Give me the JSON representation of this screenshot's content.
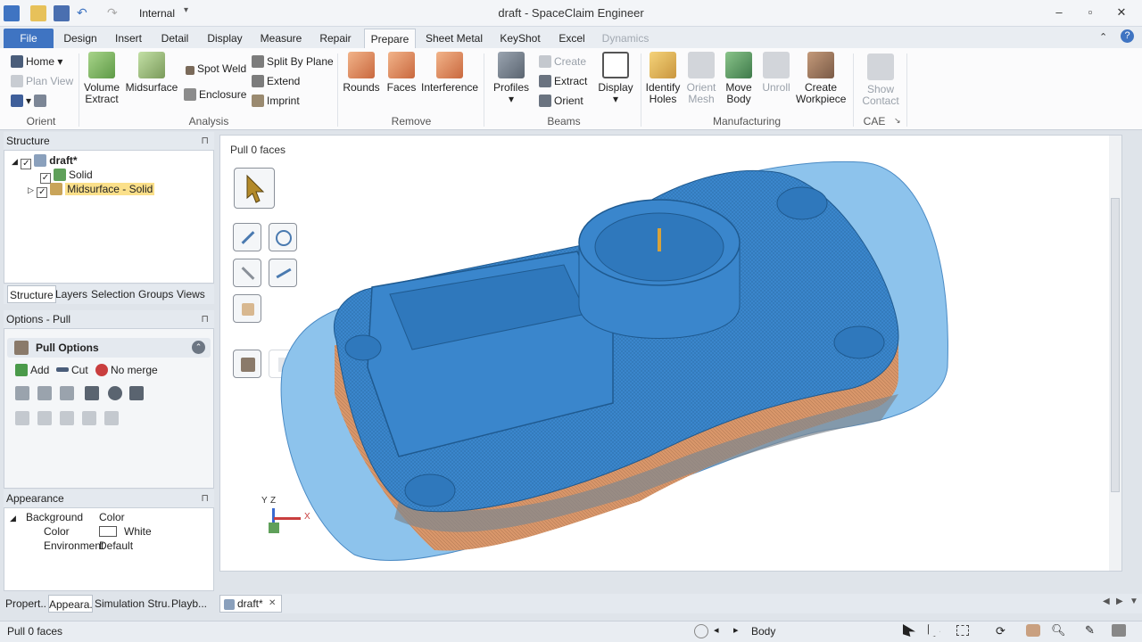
{
  "titlebar": {
    "title": "draft - SpaceClaim Engineer",
    "scheme_label": "Internal",
    "minimize": "–",
    "maximize": "▫",
    "close": "✕"
  },
  "tabs": [
    {
      "label": "File"
    },
    {
      "label": "Design"
    },
    {
      "label": "Insert"
    },
    {
      "label": "Detail"
    },
    {
      "label": "Display"
    },
    {
      "label": "Measure"
    },
    {
      "label": "Repair"
    },
    {
      "label": "Prepare"
    },
    {
      "label": "Sheet Metal"
    },
    {
      "label": "KeyShot"
    },
    {
      "label": "Excel"
    },
    {
      "label": "Dynamics"
    }
  ],
  "ribbon": {
    "orient": {
      "label": "Orient",
      "home": "Home",
      "plan_view": "Plan View"
    },
    "analysis": {
      "label": "Analysis",
      "volume_extract": [
        "Volume",
        "Extract"
      ],
      "midsurface": "Midsurface",
      "spot_weld": "Spot Weld",
      "enclosure": "Enclosure",
      "split_by_plane": "Split By Plane",
      "extend": "Extend",
      "imprint": "Imprint"
    },
    "remove": {
      "label": "Remove",
      "rounds": "Rounds",
      "faces": "Faces",
      "interference": "Interference"
    },
    "beams": {
      "label": "Beams",
      "profiles": "Profiles",
      "create": "Create",
      "extract": "Extract",
      "orient": "Orient",
      "display": "Display"
    },
    "manufacturing": {
      "label": "Manufacturing",
      "identify_holes": [
        "Identify",
        "Holes"
      ],
      "orient_mesh": [
        "Orient",
        "Mesh"
      ],
      "move_body": [
        "Move",
        "Body"
      ],
      "unroll": "Unroll",
      "create_workpiece": [
        "Create",
        "Workpiece"
      ]
    },
    "cae": {
      "label": "CAE",
      "show_contact": [
        "Show",
        "Contact"
      ]
    }
  },
  "structure": {
    "title": "Structure",
    "items": [
      {
        "label": "draft*"
      },
      {
        "label": "Solid"
      },
      {
        "label": "Midsurface - Solid"
      }
    ],
    "tabs": [
      "Structure",
      "Layers",
      "Selection",
      "Groups",
      "Views"
    ]
  },
  "options": {
    "title": "Options - Pull",
    "section": "Pull Options",
    "add": "Add",
    "cut": "Cut",
    "no_merge": "No merge"
  },
  "appearance": {
    "title": "Appearance",
    "rows": [
      {
        "name": "Background",
        "value": "Color"
      },
      {
        "name": "Color",
        "value": "White"
      },
      {
        "name": "Environment",
        "value": "Default"
      }
    ]
  },
  "bottom_tabs": [
    "Propert...",
    "Appeara...",
    "Simulation Stru...",
    "Playb..."
  ],
  "viewport": {
    "status": "Pull 0 faces",
    "doc_tab": "draft*",
    "axis_x": "X",
    "axis_y": "Y",
    "axis_z": "Z"
  },
  "statusbar": {
    "message": "Pull 0 faces",
    "selection_type": "Body"
  },
  "colors": {
    "accent": "#3f74c2",
    "part_blue": "#3a86cc",
    "midsurface_blue": "#8dc3ec",
    "orange": "#d8966a"
  }
}
